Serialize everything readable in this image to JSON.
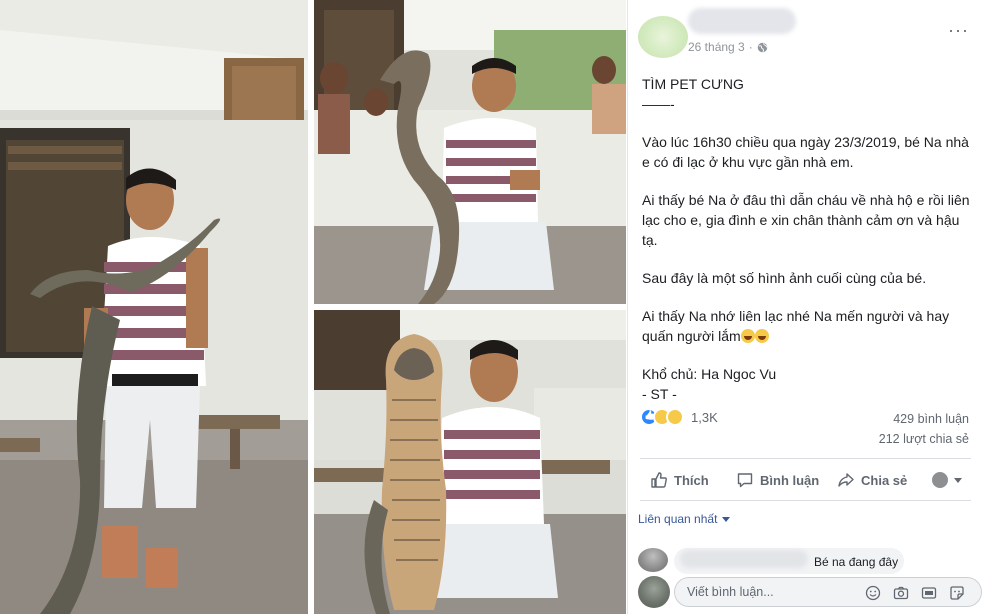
{
  "post": {
    "time": "26 tháng 3",
    "dot": "·",
    "more_label": "···",
    "title": "TÌM PET CƯNG",
    "separator": "——-",
    "para1": "Vào lúc 16h30 chiều qua ngày 23/3/2019, bé Na nhà e có đi lạc ở khu vực gần nhà em.",
    "para2": "Ai thấy bé Na ở đâu thì dẫn cháu về nhà hộ e rồi liên lạc cho e, gia đình e xin chân thành cảm ơn và hậu tạ.",
    "para3": "Sau đây là một số hình ảnh cuối cùng của bé.",
    "para4": "Ai thấy Na nhớ liên lạc nhé Na mến người và hay quấn người lắm",
    "owner_line": "Khổ chủ: Ha Ngoc Vu",
    "source_line": "- ST -"
  },
  "stats": {
    "reaction_count": "1,3K",
    "comments": "429 bình luận",
    "shares": "212 lượt chia sẻ"
  },
  "actions": {
    "like": "Thích",
    "comment": "Bình luận",
    "share": "Chia sẻ"
  },
  "sort": {
    "label": "Liên quan nhất"
  },
  "comment": {
    "text": "Bé na đang đây"
  },
  "composer": {
    "placeholder": "Viết bình luận..."
  },
  "colors": {
    "like_blue": "#2d88ff",
    "link_blue": "#385898",
    "muted": "#606770"
  },
  "icons": [
    "globe-icon",
    "more-icon",
    "like-icon",
    "comment-icon",
    "share-icon",
    "emoji-icon",
    "camera-icon",
    "gif-icon",
    "sticker-icon"
  ]
}
